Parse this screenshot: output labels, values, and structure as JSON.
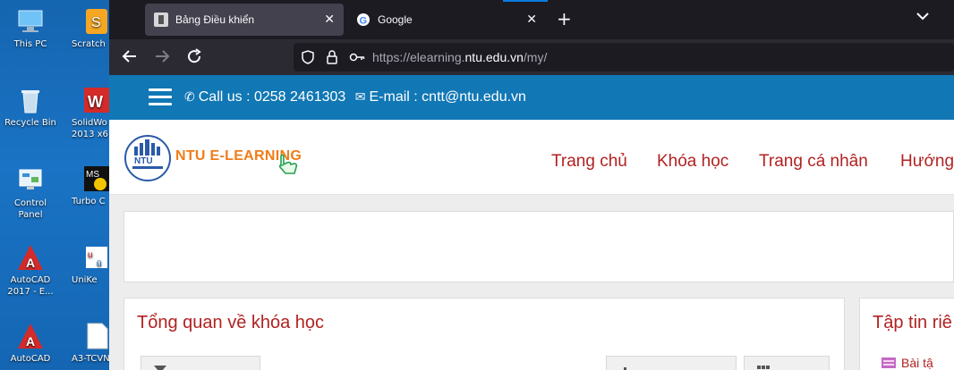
{
  "desktop": {
    "icons": [
      {
        "label": "This PC"
      },
      {
        "label": "Recycle Bin"
      },
      {
        "label": "Control Panel"
      },
      {
        "label": "AutoCAD 2017 - E..."
      },
      {
        "label": "AutoCAD"
      },
      {
        "label": "Scratch"
      },
      {
        "label": "SolidWo 2013 x6"
      },
      {
        "label": "Turbo C"
      },
      {
        "label": "UniKe"
      },
      {
        "label": "A3-TCVN"
      }
    ]
  },
  "browser": {
    "tabs": [
      {
        "title": "Bảng Điều khiển",
        "active": true
      },
      {
        "title": "Google",
        "active": false
      }
    ],
    "new_tab_glyph": "+",
    "url": {
      "prefix": "https://elearning.",
      "domain": "ntu.edu.vn",
      "path": "/my/"
    }
  },
  "site": {
    "contact": {
      "phone": "Call us : 0258 2461303",
      "email": "E-mail : cntt@ntu.edu.vn"
    },
    "brand": "NTU E-LEARNING",
    "menu": [
      "Trang chủ",
      "Khóa học",
      "Trang cá nhân",
      "Hướng"
    ],
    "overview_title": "Tổng quan về khóa học",
    "files_title": "Tập tin riê",
    "file_item": "Bài tậ"
  },
  "colors": {
    "topbar": "#1177b5",
    "accent_red": "#b22222",
    "brand_orange": "#ef7d1a"
  }
}
